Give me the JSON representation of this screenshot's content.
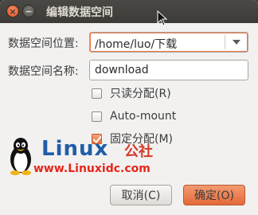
{
  "window": {
    "title": "编辑数据空间",
    "close_glyph": "×",
    "minimize_glyph": "−"
  },
  "form": {
    "location_label": "数据空间位置:",
    "location_value": "/home/luo/下载",
    "name_label": "数据空间名称:",
    "name_value": "download"
  },
  "options": [
    {
      "label": "只读分配(R)",
      "checked": false
    },
    {
      "label": "Auto-mount",
      "checked": false
    },
    {
      "label": "固定分配(M)",
      "checked": true
    }
  ],
  "watermark": {
    "word": "Linux",
    "cn": "公社",
    "url": "www.Linuxidc.com"
  },
  "buttons": {
    "cancel": "取消(C)",
    "ok": "确定(O)"
  },
  "colors": {
    "accent": "#e9703f",
    "titlebar": "#3c3b37",
    "background": "#f2f1f0"
  }
}
